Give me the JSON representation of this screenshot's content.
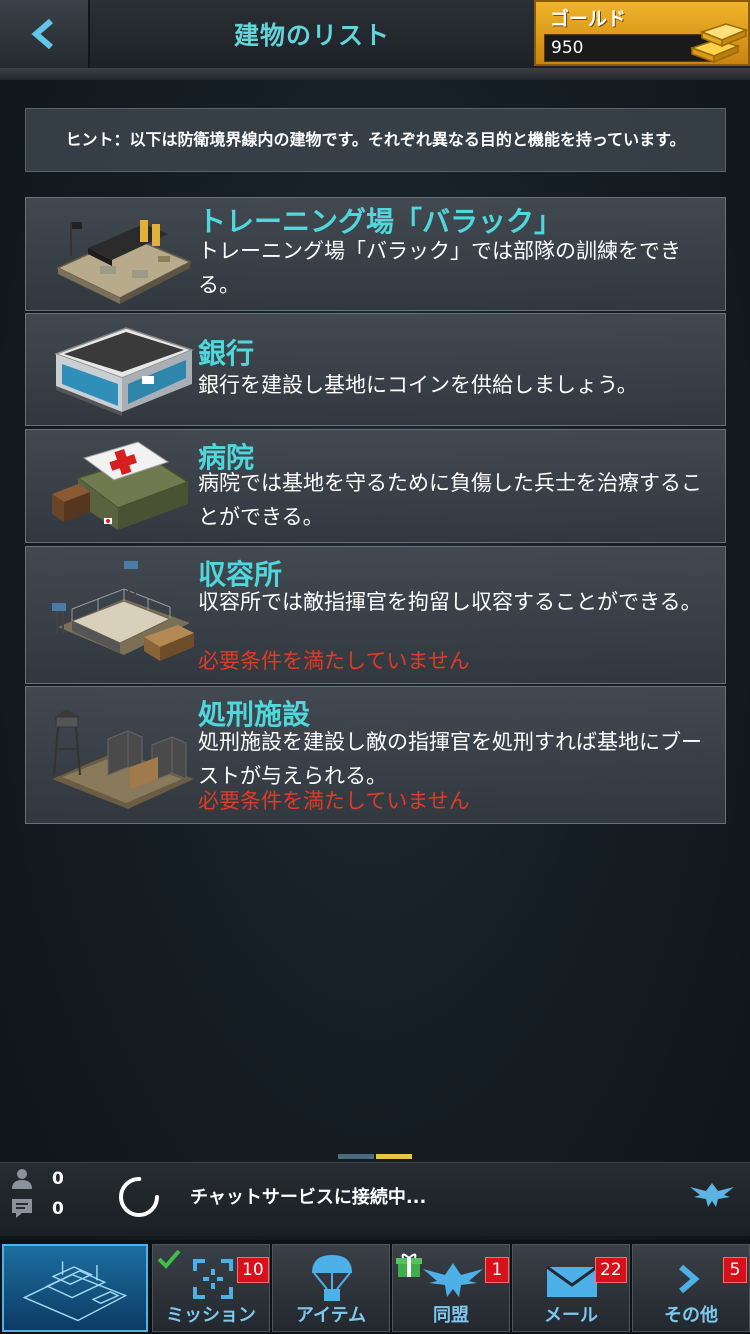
{
  "header": {
    "title": "建物のリスト",
    "gold_label": "ゴールド",
    "gold_value": "950"
  },
  "hint": "ヒント：以下は防衛境界線内の建物です。それぞれ異なる目的と機能を持っています。",
  "buildings": [
    {
      "name": "トレーニング場「バラック」",
      "description": "トレーニング場「バラック」では部隊の訓練をできる。",
      "requirement": ""
    },
    {
      "name": "銀行",
      "description": "銀行を建設し基地にコインを供給しましょう。",
      "requirement": ""
    },
    {
      "name": "病院",
      "description": "病院では基地を守るために負傷した兵士を治療することができる。",
      "requirement": ""
    },
    {
      "name": "収容所",
      "description": "収容所では敵指揮官を拘留し収容することができる。",
      "requirement": "必要条件を満たしていません"
    },
    {
      "name": "処刑施設",
      "description": "処刑施設を建設し敵の指揮官を処刑すれば基地にブーストが与えられる。",
      "requirement": "必要条件を満たしていません"
    }
  ],
  "chat": {
    "online_count": "0",
    "message_count": "0",
    "status": "チャットサービスに接続中..."
  },
  "nav": {
    "items": [
      {
        "label": "ミッション",
        "badge": "10",
        "icon": "crosshair-icon"
      },
      {
        "label": "アイテム",
        "badge": "",
        "icon": "parachute-icon"
      },
      {
        "label": "同盟",
        "badge": "1",
        "icon": "eagle-icon"
      },
      {
        "label": "メール",
        "badge": "22",
        "icon": "envelope-icon"
      },
      {
        "label": "その他",
        "badge": "5",
        "icon": "chevron-right-icon"
      }
    ]
  },
  "colors": {
    "accent": "#4fd7dc",
    "gold": "#f0b42a",
    "warning": "#e03b25",
    "badge": "#d8101c",
    "nav_label": "#7ec8ee"
  }
}
